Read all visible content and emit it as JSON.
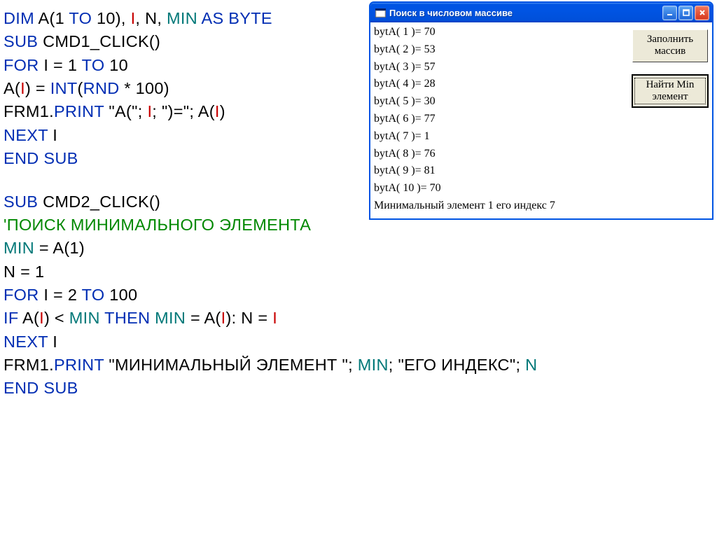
{
  "code": {
    "l1": {
      "a": "DIM",
      "b": " A(1 ",
      "c": "TO",
      "d": " 10), ",
      "e": "I",
      "f": ", N, ",
      "g": "MIN",
      "h": " AS BYTE"
    },
    "l2": {
      "a": "SUB",
      "b": " CMD1_CLICK()"
    },
    "l3": {
      "a": "FOR",
      "b": " I = 1 ",
      "c": "TO",
      "d": " 10"
    },
    "l4": {
      "a": "A(",
      "b": "I",
      "c": ") = ",
      "d": "INT",
      "e": "(",
      "f": "RND",
      "g": " * 100)"
    },
    "l5": {
      "a": "FRM1.",
      "b": "PRINT",
      "c": " \"A(\"; ",
      "d": "I",
      "e": "; \")=\"; A(",
      "f": "I",
      "g": ")"
    },
    "l6": {
      "a": "NEXT",
      "b": " I"
    },
    "l7": {
      "a": "END SUB"
    },
    "l9": {
      "a": "SUB",
      "b": " CMD2_CLICK()"
    },
    "l10": {
      "a": "'ПОИСК МИНИМАЛЬНОГО ЭЛЕМЕНТА"
    },
    "l11": {
      "a": "MIN",
      "b": " = A(1)"
    },
    "l12": {
      "a": "N = 1"
    },
    "l13": {
      "a": "FOR",
      "b": " I = 2 ",
      "c": "TO",
      "d": " 100"
    },
    "l14": {
      "a": "IF",
      "b": " A(",
      "c": "I",
      "d": ") < ",
      "e": "MIN",
      "f": " THEN ",
      "g": "MIN",
      "h": " = A(",
      "i": "I",
      "j": "): N = ",
      "k": "I"
    },
    "l15": {
      "a": "NEXT",
      "b": " I"
    },
    "l16": {
      "a": "FRM1.",
      "b": "PRINT",
      "c": " \"МИНИМАЛЬНЫЙ ЭЛЕМЕНТ  \"; ",
      "d": "MIN",
      "e": "; \"ЕГО ИНДЕКС\"; ",
      "f": "N"
    },
    "l17": {
      "a": "END SUB"
    }
  },
  "window": {
    "title": "Поиск в числовом массиве",
    "output": [
      "bytA( 1 )= 70",
      "bytA( 2 )= 53",
      "bytA( 3 )= 57",
      "bytA( 4 )= 28",
      "bytA( 5 )= 30",
      "bytA( 6 )= 77",
      "bytA( 7 )= 1",
      "bytA( 8 )= 76",
      "bytA( 9 )= 81",
      "bytA( 10 )= 70"
    ],
    "result": "Минимальный элемент   1 его индекс 7",
    "buttons": {
      "fill": "Заполнить массив",
      "find": "Найти Min элемент"
    }
  }
}
